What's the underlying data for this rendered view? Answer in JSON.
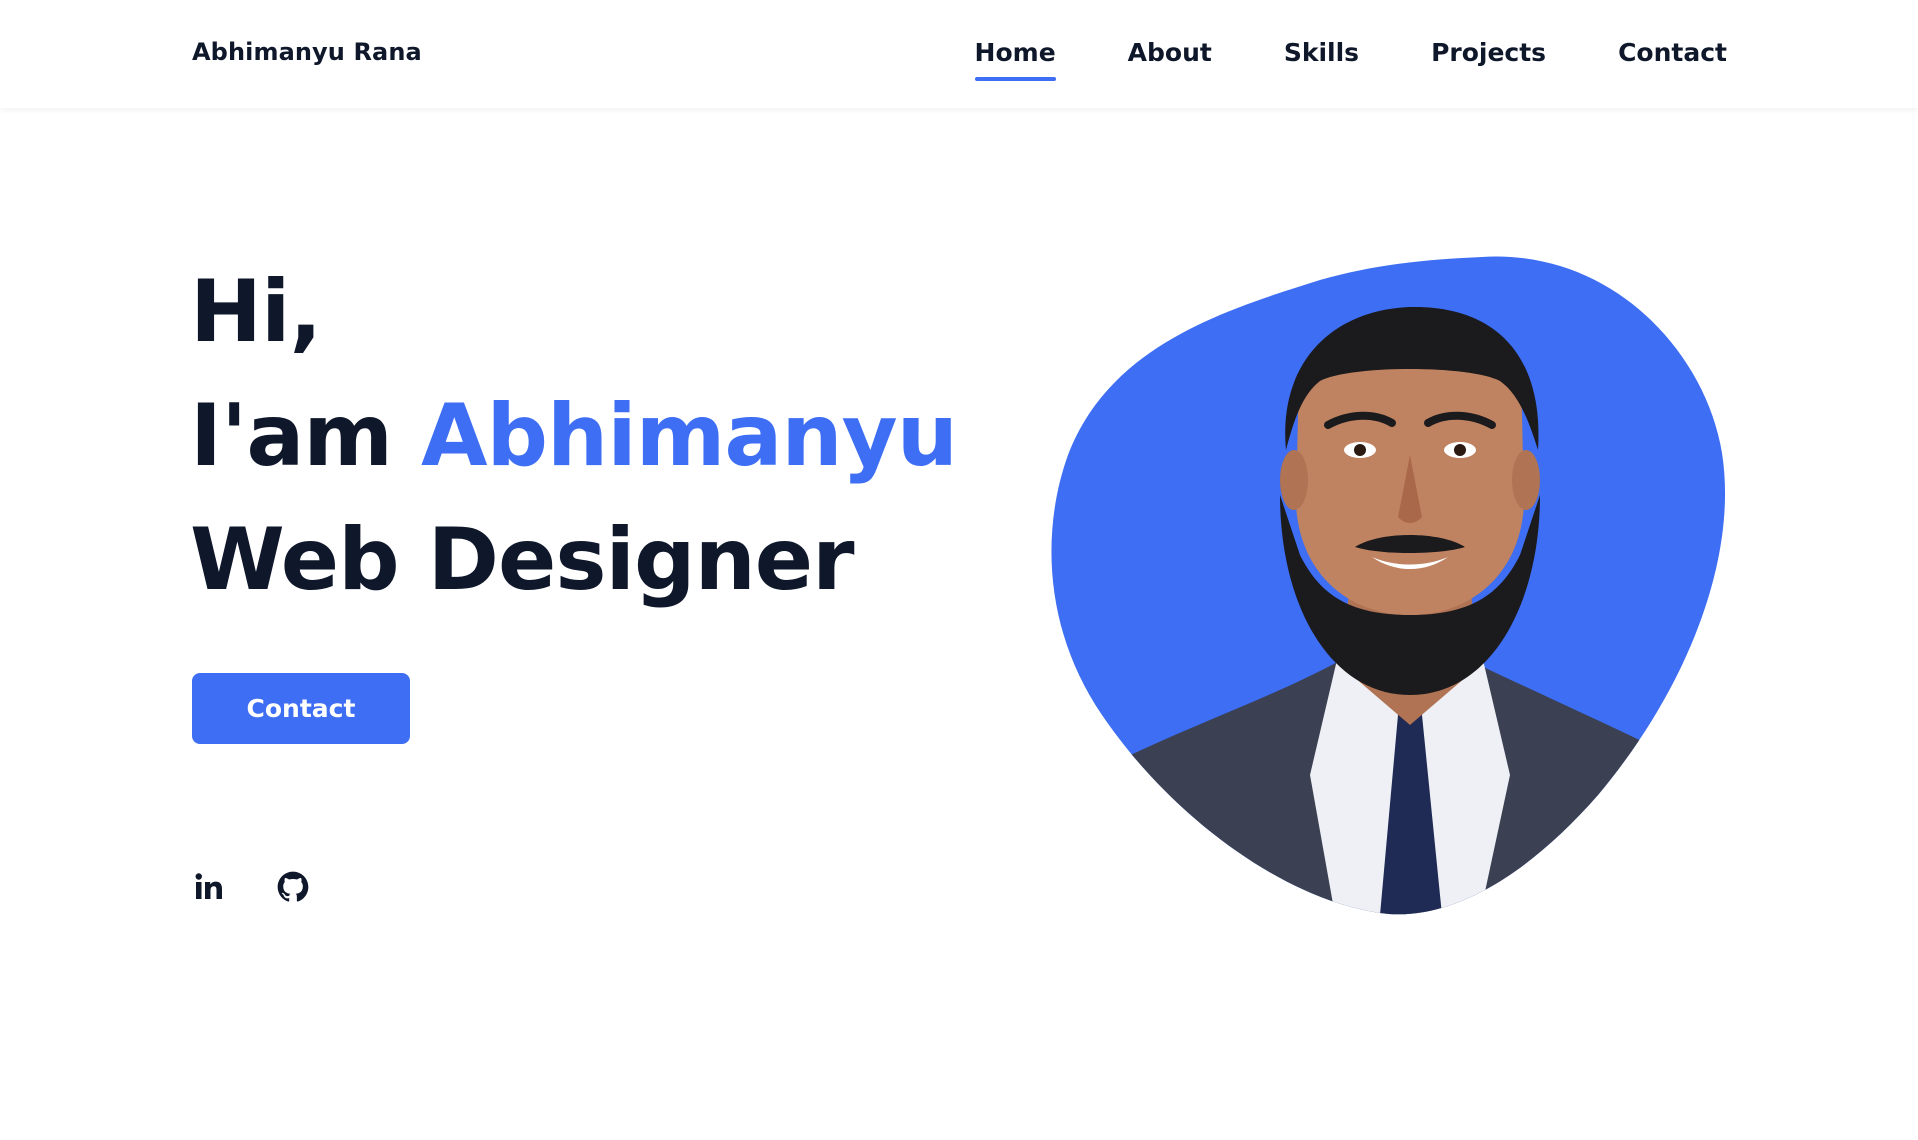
{
  "header": {
    "brand": "Abhimanyu Rana",
    "nav": [
      {
        "label": "Home",
        "active": true
      },
      {
        "label": "About",
        "active": false
      },
      {
        "label": "Skills",
        "active": false
      },
      {
        "label": "Projects",
        "active": false
      },
      {
        "label": "Contact",
        "active": false
      }
    ]
  },
  "hero": {
    "greeting": "Hi,",
    "intro_prefix": "I'am",
    "name": "Abhimanyu",
    "role": "Web Designer",
    "cta_label": "Contact"
  },
  "socials": [
    {
      "icon": "linkedin-icon"
    },
    {
      "icon": "github-icon"
    }
  ],
  "colors": {
    "accent": "#3d6ef3",
    "text": "#0f172a",
    "background": "#ffffff"
  }
}
